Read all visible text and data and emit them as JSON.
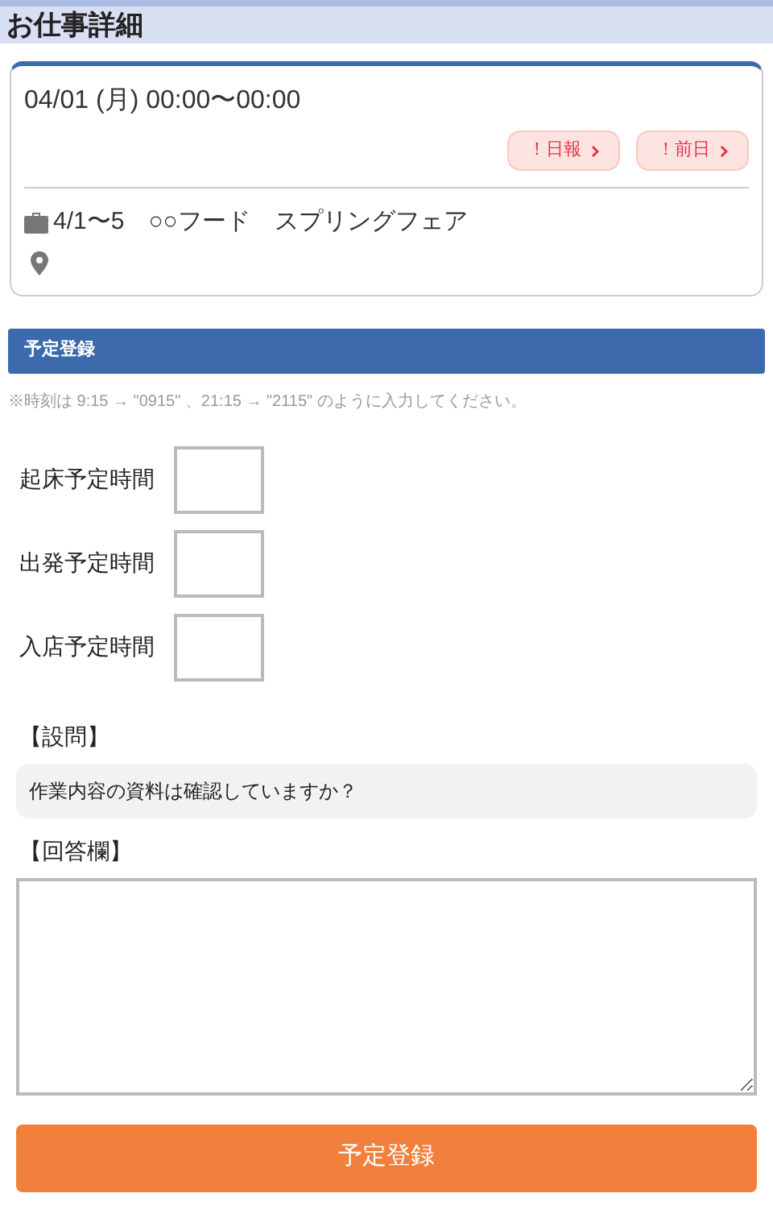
{
  "header": {
    "title": "お仕事詳細"
  },
  "job": {
    "datetime": "04/01 (月)  00:00〜00:00",
    "badges": [
      {
        "label": "！日報"
      },
      {
        "label": "！前日"
      }
    ],
    "name": "4/1〜5　○○フード　スプリングフェア"
  },
  "section": {
    "title": "予定登録"
  },
  "note": "※時刻は 9:15 → \"0915\" 、21:15 → \"2115\" のように入力してください。",
  "time_fields": [
    {
      "label": "起床予定時間"
    },
    {
      "label": "出発予定時間"
    },
    {
      "label": "入店予定時間"
    }
  ],
  "question": {
    "heading": "【設問】",
    "text": "作業内容の資料は確認していますか？"
  },
  "answer": {
    "heading": "【回答欄】"
  },
  "submit": {
    "label": "予定登録"
  }
}
